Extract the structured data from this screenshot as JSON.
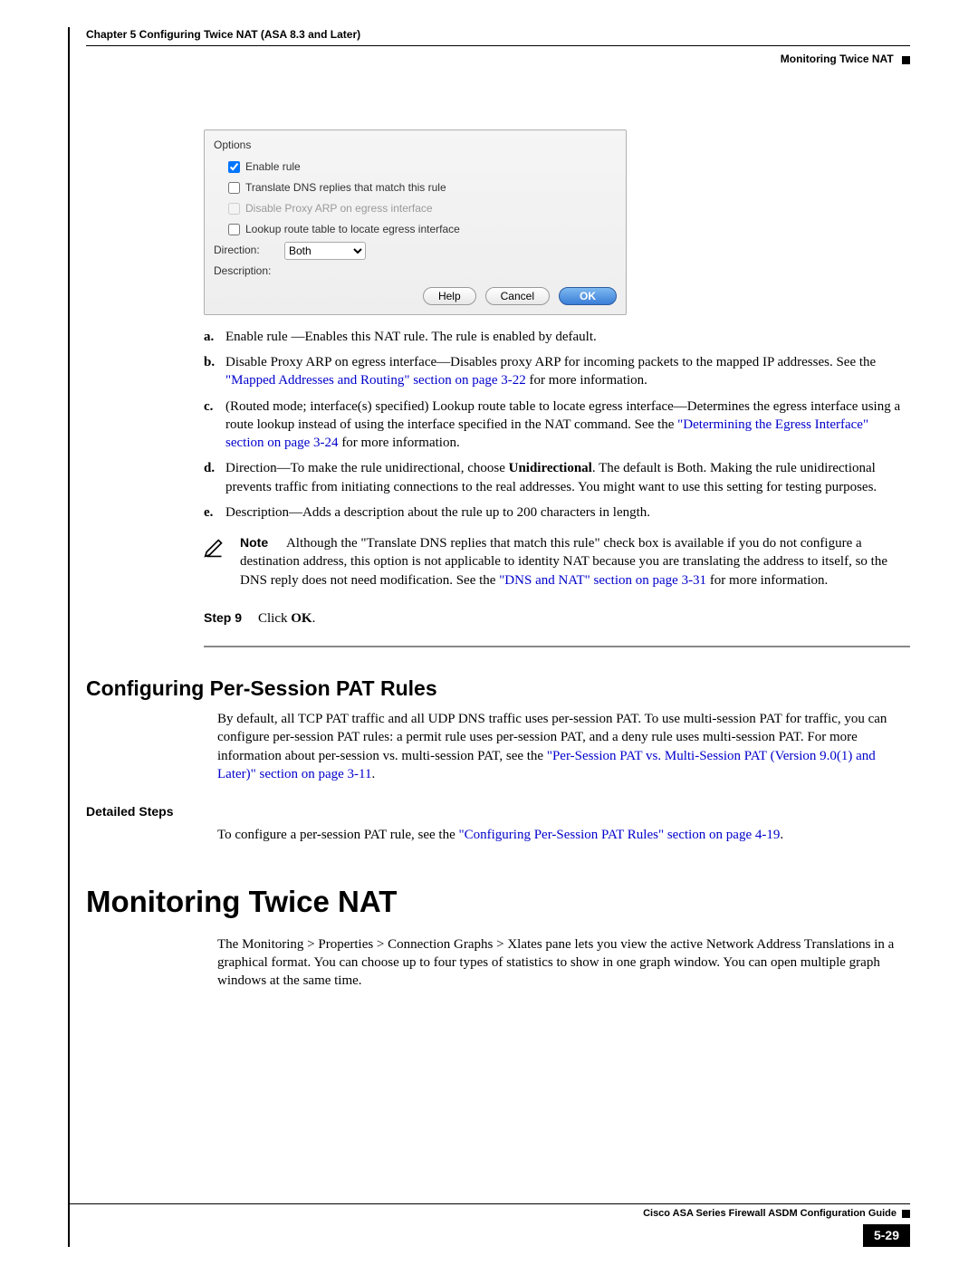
{
  "header": {
    "chapter": "Chapter 5      Configuring Twice NAT (ASA 8.3 and Later)",
    "section": "Monitoring Twice NAT"
  },
  "dialog": {
    "group_title": "Options",
    "enable_rule_label": "Enable rule",
    "enable_rule_checked": true,
    "translate_dns_label": "Translate DNS replies that match this rule",
    "translate_dns_checked": false,
    "disable_proxy_label": "Disable Proxy ARP on egress interface",
    "lookup_route_label": "Lookup route table to locate egress interface",
    "direction_label": "Direction:",
    "direction_value": "Both",
    "description_label": "Description:",
    "help_btn": "Help",
    "cancel_btn": "Cancel",
    "ok_btn": "OK"
  },
  "items": {
    "a": {
      "mk": "a.",
      "text": "Enable rule —Enables this NAT rule. The rule is enabled by default."
    },
    "b": {
      "mk": "b.",
      "pre": "Disable Proxy ARP on egress interface—Disables proxy ARP for incoming packets to the mapped IP addresses. See the ",
      "link": "\"Mapped Addresses and Routing\" section on page 3-22",
      "post": " for more information."
    },
    "c": {
      "mk": "c.",
      "pre": "(Routed mode; interface(s) specified) Lookup route table to locate egress interface—Determines the egress interface using a route lookup instead of using the interface specified in the NAT command. See the ",
      "link": "\"Determining the Egress Interface\" section on page 3-24",
      "post": " for more information."
    },
    "d": {
      "mk": "d.",
      "pre": "Direction—To make the rule unidirectional, choose ",
      "bold": "Unidirectional",
      "post": ". The default is Both. Making the rule unidirectional prevents traffic from initiating connections to the real addresses. You might want to use this setting for testing purposes."
    },
    "e": {
      "mk": "e.",
      "text": "Description—Adds a description about the rule up to 200 characters in length."
    }
  },
  "note": {
    "label": "Note",
    "pre": "Although the \"Translate DNS replies that match this rule\" check box is available if you do not configure a destination address, this option is not applicable to identity NAT because you are translating the address to itself, so the DNS reply does not need modification. See the ",
    "link": "\"DNS and NAT\" section on page 3-31",
    "post": " for more information."
  },
  "step9": {
    "label": "Step 9",
    "pre": "Click ",
    "bold": "OK",
    "post": "."
  },
  "pat": {
    "heading": "Configuring Per-Session PAT Rules",
    "body_pre": "By default, all TCP PAT traffic and all UDP DNS traffic uses per-session PAT. To use multi-session PAT for traffic, you can configure per-session PAT rules: a permit rule uses per-session PAT, and a deny rule uses multi-session PAT. For more information about per-session vs. multi-session PAT, see the ",
    "body_link": "\"Per-Session PAT vs. Multi-Session PAT (Version 9.0(1) and Later)\" section on page 3-11",
    "body_post": ".",
    "detailed_label": "Detailed Steps",
    "steps_pre": "To configure a per-session PAT rule, see the ",
    "steps_link": "\"Configuring Per-Session PAT Rules\" section on page 4-19",
    "steps_post": "."
  },
  "monitor": {
    "heading": "Monitoring Twice NAT",
    "body": "The Monitoring > Properties > Connection Graphs > Xlates pane lets you view the active Network Address Translations in a graphical format. You can choose up to four types of statistics to show in one graph window. You can open multiple graph windows at the same time."
  },
  "footer": {
    "guide": "Cisco ASA Series Firewall ASDM Configuration Guide",
    "page": "5-29"
  }
}
